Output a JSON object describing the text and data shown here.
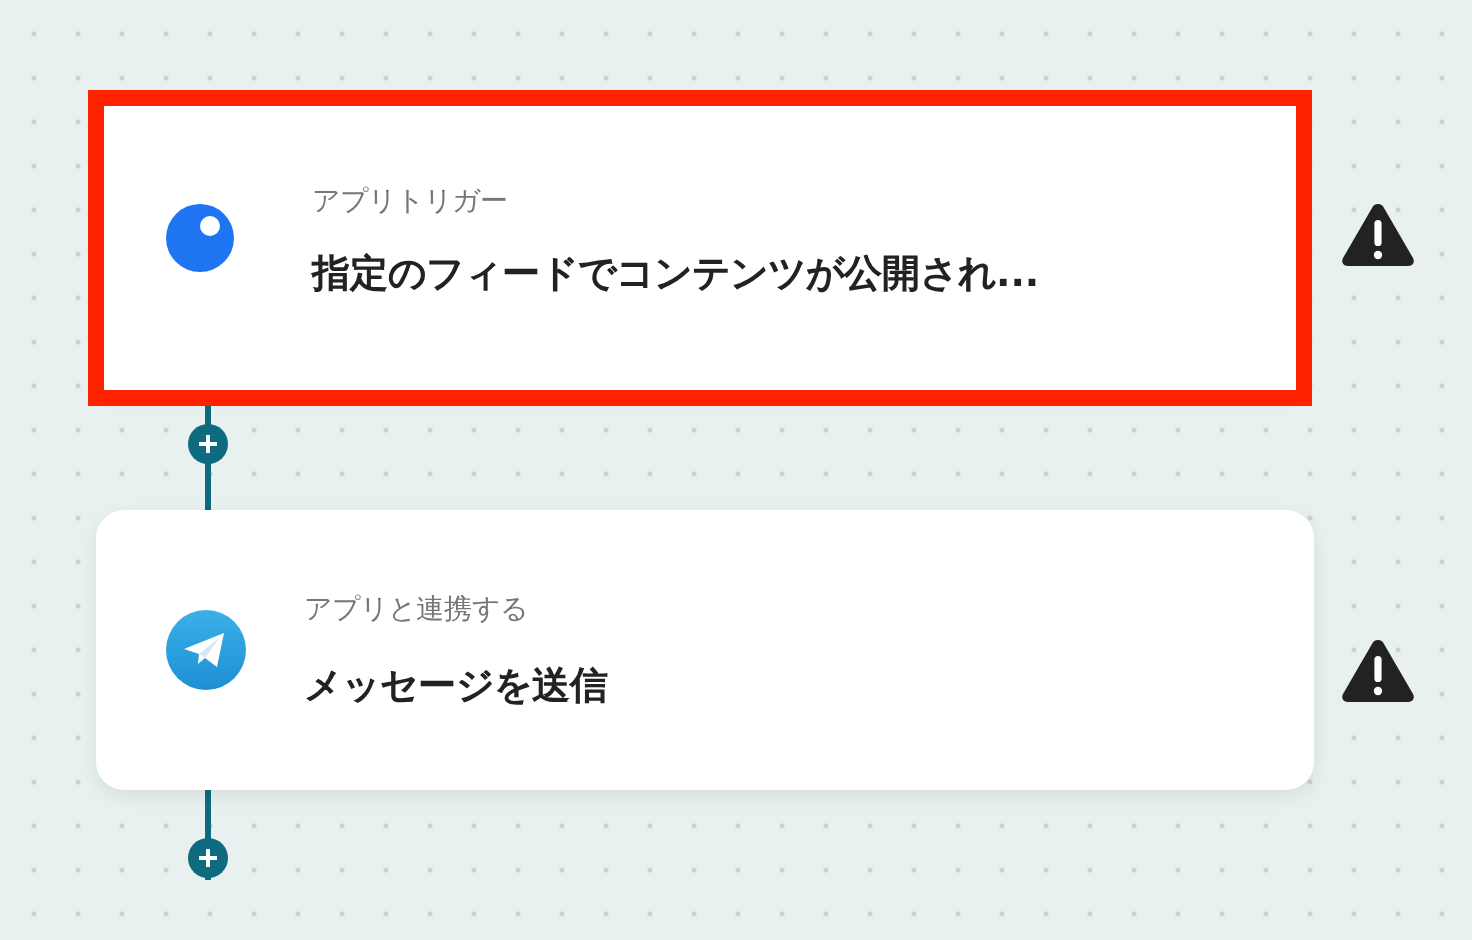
{
  "steps": [
    {
      "kind": "trigger",
      "label": "アプリトリガー",
      "title": "指定のフィードでコンテンツが公開され...",
      "highlighted": true,
      "warning": true
    },
    {
      "kind": "telegram",
      "label": "アプリと連携する",
      "title": "メッセージを送信",
      "highlighted": false,
      "warning": true
    }
  ]
}
